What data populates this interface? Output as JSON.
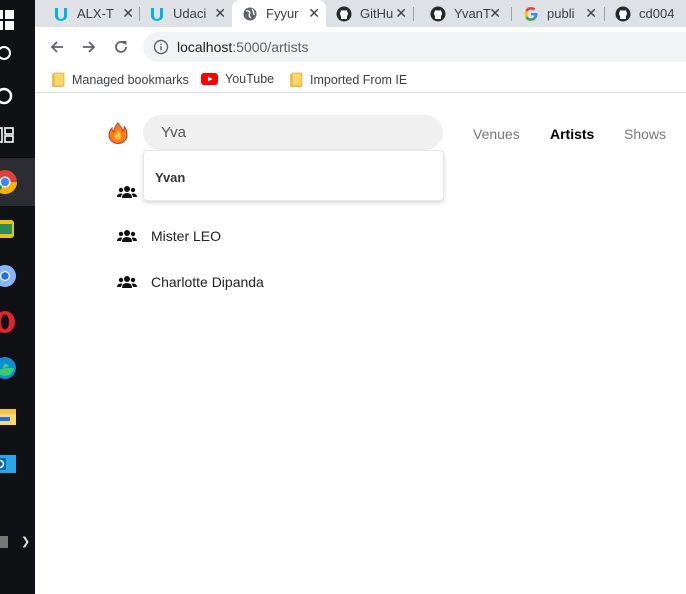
{
  "browser": {
    "tabs": [
      {
        "title": "ALX-T",
        "icon": "udacity-icon",
        "active": false
      },
      {
        "title": "Udaci",
        "icon": "udacity-icon",
        "active": false
      },
      {
        "title": "Fyyur",
        "icon": "globe-icon",
        "active": true
      },
      {
        "title": "GitHu",
        "icon": "github-icon",
        "active": false
      },
      {
        "title": "YvanT",
        "icon": "github-icon",
        "active": false
      },
      {
        "title": "publi",
        "icon": "google-icon",
        "active": false
      },
      {
        "title": "cd004",
        "icon": "github-icon",
        "active": false
      }
    ],
    "url_host": "localhost",
    "url_path": ":5000/artists",
    "bookmarks": [
      {
        "label": "Managed bookmarks",
        "icon": "folder-icon"
      },
      {
        "label": "YouTube",
        "icon": "youtube-icon"
      },
      {
        "label": "Imported From IE",
        "icon": "folder-icon"
      }
    ]
  },
  "page": {
    "search_value": "Yva",
    "suggestion": "Yvan",
    "nav": {
      "venues": "Venues",
      "artists": "Artists",
      "shows": "Shows"
    },
    "artists": [
      "Mister LEO",
      "Charlotte Dipanda"
    ]
  },
  "colors": {
    "accent": "#1a73e8",
    "tabstrip": "#dee1e6",
    "taskbar": "#101114"
  }
}
